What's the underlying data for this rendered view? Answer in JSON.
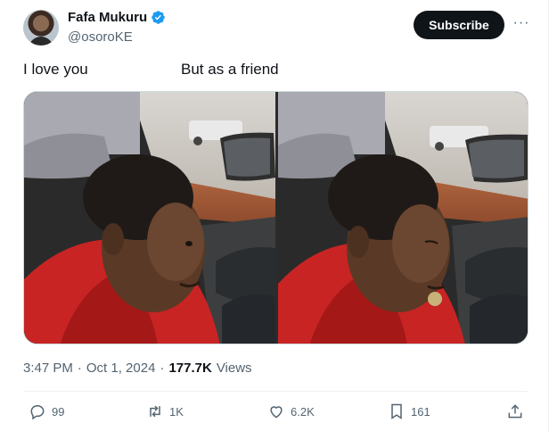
{
  "author": {
    "name": "Fafa Mukuru",
    "handle": "@osoroKE"
  },
  "header": {
    "subscribe_label": "Subscribe",
    "more_label": "···"
  },
  "tweet": {
    "text_left": "I love you",
    "text_right": "But as a friend"
  },
  "meta": {
    "time": "3:47 PM",
    "sep1": "·",
    "date": "Oct 1, 2024",
    "sep2": "·",
    "views_count": "177.7K",
    "views_label": "Views"
  },
  "actions": {
    "replies": "99",
    "reposts": "1K",
    "likes": "6.2K",
    "bookmarks": "161"
  },
  "colors": {
    "verified": "#1d9bf0",
    "text_primary": "#0f1419",
    "text_secondary": "#536471"
  },
  "icons": [
    "verified-badge-icon",
    "more-icon",
    "reply-icon",
    "repost-icon",
    "like-icon",
    "bookmark-icon",
    "share-icon"
  ]
}
